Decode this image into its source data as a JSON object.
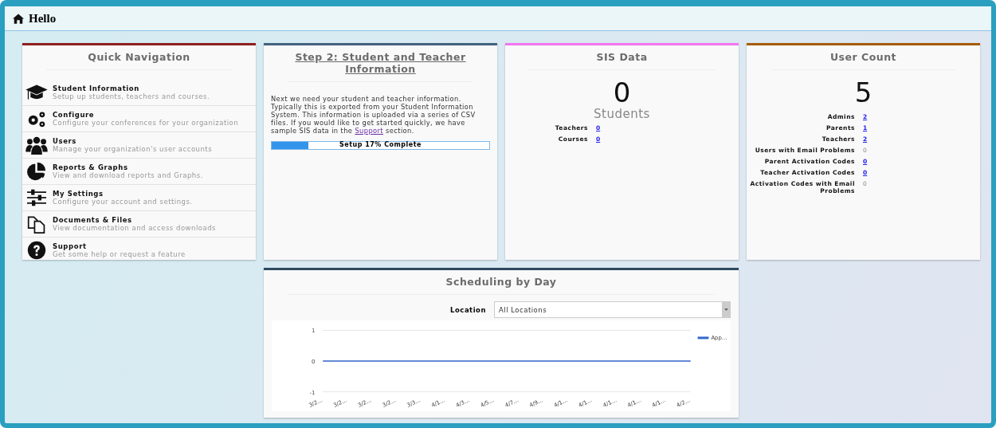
{
  "header": {
    "title": "Hello"
  },
  "quick_navigation": {
    "title": "Quick Navigation",
    "items": [
      {
        "title": "Student Information",
        "description": "Setup up students, teachers and courses."
      },
      {
        "title": "Configure",
        "description": "Configure your conferences for your organization"
      },
      {
        "title": "Users",
        "description": "Manage your organization's user accounts"
      },
      {
        "title": "Reports & Graphs",
        "description": "View and download reports and Graphs."
      },
      {
        "title": "My Settings",
        "description": "Configure your account and settings."
      },
      {
        "title": "Documents & Files",
        "description": "View documentation and access downloads"
      },
      {
        "title": "Support",
        "description": "Get some help or request a feature"
      }
    ]
  },
  "step": {
    "title": "Step 2: Student and Teacher Information",
    "text_before": "Next we need your student and teacher information. Typically this is exported from your Student Information System. This information is uploaded via a series of CSV files. If you would like to get started quickly, we have sample SIS data in the ",
    "link": "Support",
    "text_after": " section.",
    "progress": {
      "level": 0.17,
      "label": "Setup 17% Complete"
    }
  },
  "sis_data": {
    "title": "SIS Data",
    "big_number": "0",
    "big_label": "Students",
    "stats": [
      {
        "label": "Teachers",
        "value": "0",
        "kind": "link"
      },
      {
        "label": "Courses",
        "value": "0",
        "kind": "link"
      }
    ]
  },
  "user_count": {
    "title": "User Count",
    "big_number": "5",
    "stats": [
      {
        "label": "Admins",
        "value": "2",
        "kind": "link"
      },
      {
        "label": "Parents",
        "value": "1",
        "kind": "link"
      },
      {
        "label": "Teachers",
        "value": "2",
        "kind": "link"
      },
      {
        "label": "Users with Email Problems",
        "value": "0",
        "kind": "plain"
      },
      {
        "label": "Parent Activation Codes",
        "value": "0",
        "kind": "link"
      },
      {
        "label": "Teacher Activation Codes",
        "value": "0",
        "kind": "link"
      },
      {
        "label": "Activation Codes with Email Problems",
        "value": "0",
        "kind": "plain"
      }
    ]
  },
  "scheduling": {
    "title": "Scheduling by Day",
    "location_label": "Location",
    "location_value": "All Locations",
    "chart_data": {
      "type": "line",
      "categories": [
        "3/2…",
        "3/2…",
        "3/2…",
        "3/2…",
        "3/3…",
        "4/1…",
        "4/3…",
        "4/5…",
        "4/7…",
        "4/9…",
        "4/1…",
        "4/1…",
        "4/1…",
        "4/1…",
        "4/1…",
        "4/2…"
      ],
      "series": [
        {
          "name": "App…",
          "color": "#3366cc",
          "values": [
            0,
            0,
            0,
            0,
            0,
            0,
            0,
            0,
            0,
            0,
            0,
            0,
            0,
            0,
            0,
            0
          ]
        }
      ],
      "ylim": [
        -1,
        1
      ],
      "yticks": [
        -1,
        0,
        1
      ]
    }
  }
}
